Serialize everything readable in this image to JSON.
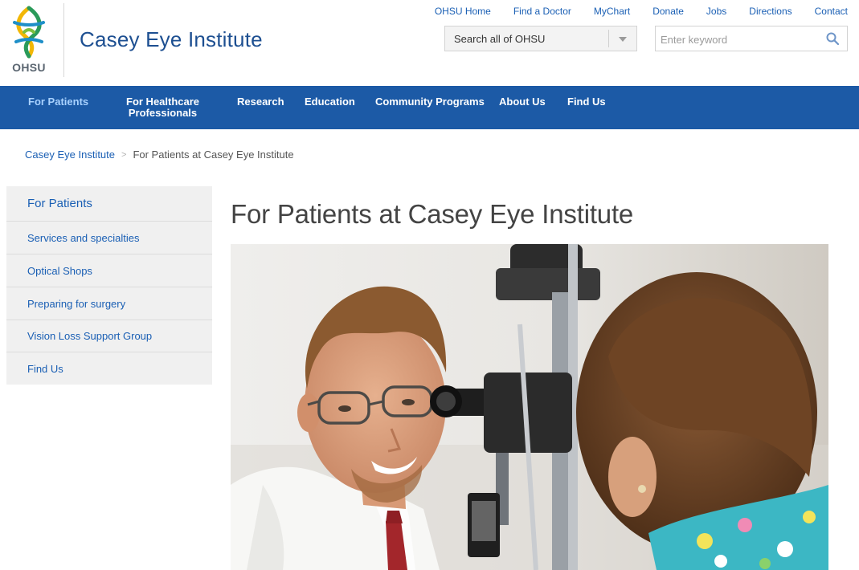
{
  "header": {
    "logo_text": "OHSU",
    "site_title": "Casey Eye Institute",
    "utility_links": [
      "OHSU Home",
      "Find a Doctor",
      "MyChart",
      "Donate",
      "Jobs",
      "Directions",
      "Contact"
    ],
    "search_scope": "Search all of OHSU",
    "search_placeholder": "Enter keyword"
  },
  "nav": {
    "items": [
      {
        "line1": "For Patients",
        "line2": ""
      },
      {
        "line1": "For Healthcare",
        "line2": "Professionals"
      },
      {
        "line1": "Research",
        "line2": ""
      },
      {
        "line1": "Education",
        "line2": ""
      },
      {
        "line1": "Community Programs",
        "line2": ""
      },
      {
        "line1": "About Us",
        "line2": ""
      },
      {
        "line1": "Find Us",
        "line2": ""
      }
    ],
    "active_index": 0
  },
  "breadcrumb": {
    "home": "Casey Eye Institute",
    "separator": ">",
    "current": "For Patients at Casey Eye Institute"
  },
  "sidebar": {
    "heading": "For Patients",
    "items": [
      "Services and specialties",
      "Optical Shops",
      "Preparing for surgery",
      "Vision Loss Support Group",
      "Find Us"
    ]
  },
  "main": {
    "title": "For Patients at Casey Eye Institute",
    "hero_alt_icon": "photo-doctor-eye-exam"
  },
  "colors": {
    "brand_blue": "#1c5aa6",
    "link_blue": "#1a5fb4",
    "nav_active": "#a9d2ff",
    "sidebar_bg": "#f0f0f0"
  }
}
